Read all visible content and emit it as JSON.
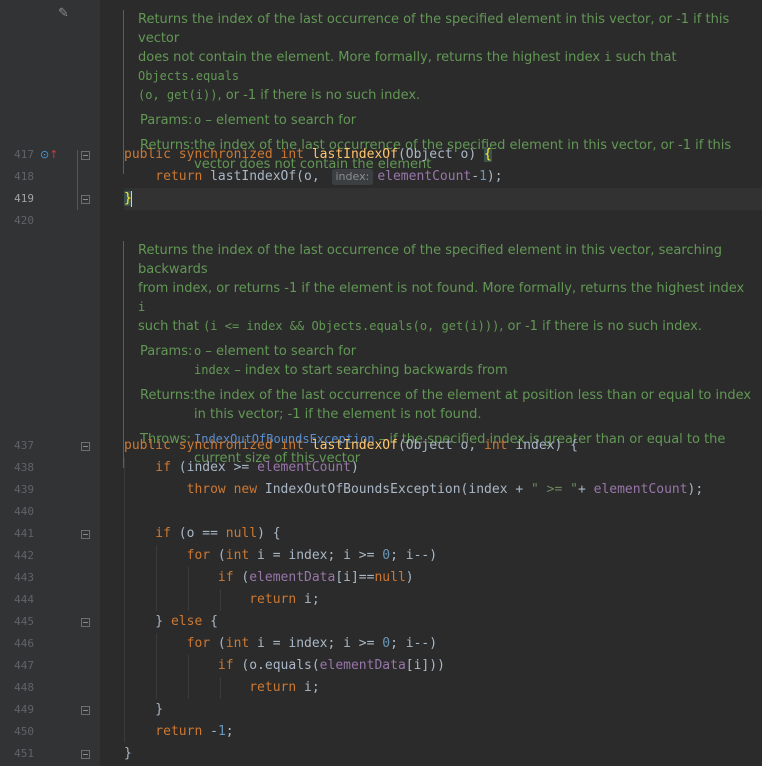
{
  "icons": {
    "edit": "pencil-icon",
    "override": "override-up-icon",
    "fold": "fold-icon"
  },
  "doc1": {
    "d1": "Returns the index of the last occurrence of the specified element in this vector, or -1 if this vector",
    "d2a": "does not contain the element. More formally, returns the highest index ",
    "d2b": "i",
    "d2c": " such that ",
    "d2d": "Objects.equals",
    "d3a": "(o, get(i))",
    "d3b": ", or -1 if there is no such index.",
    "params_label": "Params:",
    "param_o_name": "o",
    "param_o_desc": " – element to search for",
    "returns_label": "Returns:",
    "returns_desc": "the index of the last occurrence of the specified element in this vector, or -1 if this vector does not contain the element"
  },
  "doc2": {
    "d1": "Returns the index of the last occurrence of the specified element in this vector, searching backwards",
    "d2a": "from index, or returns -1 if the element is not found. More formally, returns the highest index ",
    "d2b": "i",
    "d3a": "such that ",
    "d3b": "(i <= index && Objects.equals(o, get(i)))",
    "d3c": ", or -1 if there is no such index.",
    "params_label": "Params:",
    "param_o_name": "o",
    "param_o_desc": " – element to search for",
    "param_index_name": "index",
    "param_index_desc": " – index to start searching backwards from",
    "returns_label": "Returns:",
    "returns_desc": "the index of the last occurrence of the element at position less than or equal to index in this vector; -1 if the element is not found.",
    "throws_label": "Throws:",
    "throws_link": "IndexOutOfBoundsException",
    "throws_desc": " – if the specified index is greater than or equal to the current size of this vector"
  },
  "line_numbers": {
    "l417": "417",
    "l418": "418",
    "l419": "419",
    "l420": "420",
    "l437": "437",
    "l438": "438",
    "l439": "439",
    "l440": "440",
    "l441": "441",
    "l442": "442",
    "l443": "443",
    "l444": "444",
    "l445": "445",
    "l446": "446",
    "l447": "447",
    "l448": "448",
    "l449": "449",
    "l450": "450",
    "l451": "451"
  },
  "code": {
    "c417": {
      "a": "public synchronized int ",
      "b": "lastIndexOf",
      "c": "(Object o) ",
      "d": "{"
    },
    "c418": {
      "a": "    return ",
      "b": "lastIndexOf(o, ",
      "hint": "index:",
      "c": "elementCount",
      "d": "-",
      "e": "1",
      "f": ");"
    },
    "c419": {
      "a": "}"
    },
    "c437": {
      "a": "public synchronized int ",
      "b": "lastIndexOf",
      "c": "(Object o, ",
      "d": "int",
      "e": " index) {"
    },
    "c438": {
      "a": "    if",
      "b": " (index >= ",
      "c": "elementCount",
      "d": ")"
    },
    "c439": {
      "a": "        throw new ",
      "b": "IndexOutOfBoundsException(index + ",
      "c": "\" >= \"",
      "d": "+ ",
      "e": "elementCount",
      "f": ");"
    },
    "c441": {
      "a": "    if",
      "b": " (o == ",
      "c": "null",
      "d": ") {"
    },
    "c442": {
      "a": "        for",
      "b": " (",
      "c": "int",
      "d": " i = index; i >= ",
      "e": "0",
      "f": "; i--)"
    },
    "c443": {
      "a": "            if",
      "b": " (",
      "c": "elementData",
      "d": "[i]==",
      "e": "null",
      "f": ")"
    },
    "c444": {
      "a": "                return",
      "b": " i;"
    },
    "c445": {
      "a": "    } ",
      "b": "else",
      "c": " {"
    },
    "c446": {
      "a": "        for",
      "b": " (",
      "c": "int",
      "d": " i = index; i >= ",
      "e": "0",
      "f": "; i--)"
    },
    "c447": {
      "a": "            if",
      "b": " (o.equals(",
      "c": "elementData",
      "d": "[i]))"
    },
    "c448": {
      "a": "                return",
      "b": " i;"
    },
    "c449": {
      "a": "    }"
    },
    "c450": {
      "a": "    return",
      "b": " -",
      "c": "1",
      "d": ";"
    },
    "c451": {
      "a": "}"
    }
  }
}
